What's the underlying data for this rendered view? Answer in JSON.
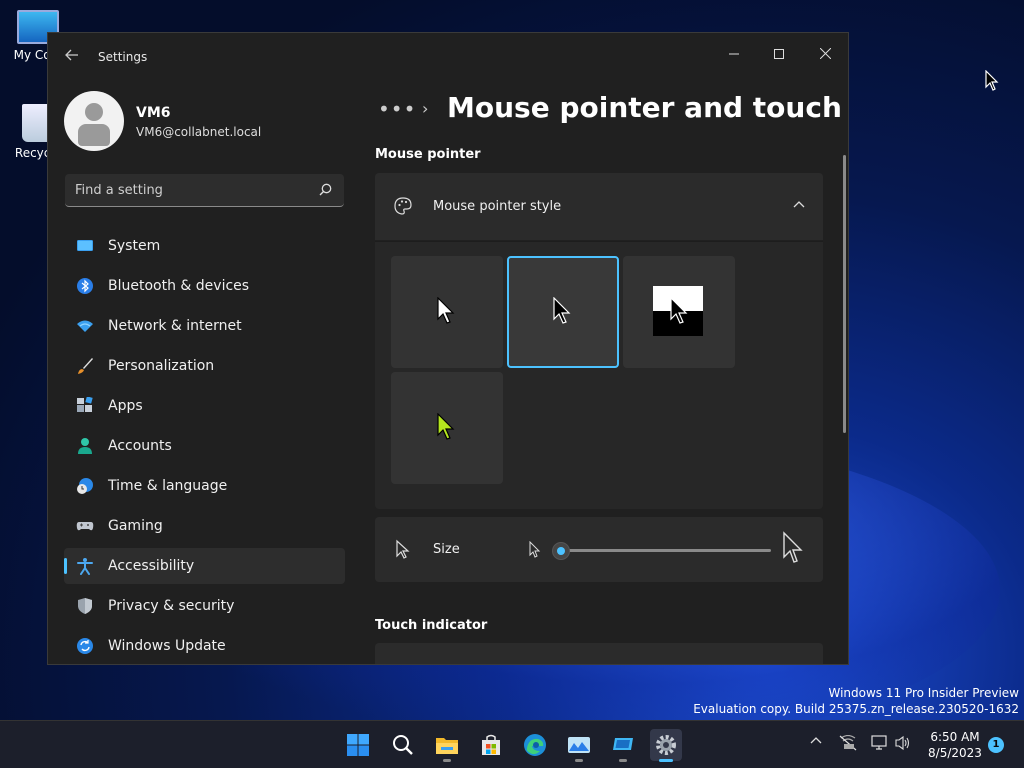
{
  "desktop": {
    "icons": [
      {
        "label": "My Com"
      },
      {
        "label": "Recycle"
      }
    ],
    "watermark": {
      "line1": "Windows 11 Pro Insider Preview",
      "line2": "Evaluation copy. Build 25375.zn_release.230520-1632"
    }
  },
  "window": {
    "title": "Settings",
    "controls": {
      "minimize": "—",
      "maximize": "☐",
      "close": "✕"
    }
  },
  "profile": {
    "name": "VM6",
    "email": "VM6@collabnet.local"
  },
  "search": {
    "placeholder": "Find a setting"
  },
  "nav": {
    "items": [
      {
        "label": "System",
        "icon": "system-icon"
      },
      {
        "label": "Bluetooth & devices",
        "icon": "bluetooth-icon"
      },
      {
        "label": "Network & internet",
        "icon": "wifi-icon"
      },
      {
        "label": "Personalization",
        "icon": "brush-icon"
      },
      {
        "label": "Apps",
        "icon": "apps-icon"
      },
      {
        "label": "Accounts",
        "icon": "person-icon"
      },
      {
        "label": "Time & language",
        "icon": "globe-clock-icon"
      },
      {
        "label": "Gaming",
        "icon": "controller-icon"
      },
      {
        "label": "Accessibility",
        "icon": "accessibility-icon",
        "active": true
      },
      {
        "label": "Privacy & security",
        "icon": "shield-icon"
      },
      {
        "label": "Windows Update",
        "icon": "update-icon"
      }
    ]
  },
  "content": {
    "breadcrumb_dots": "•••",
    "breadcrumb_chevron": "›",
    "title": "Mouse pointer and touch",
    "sections": {
      "mouse_pointer": "Mouse pointer",
      "touch_indicator": "Touch indicator"
    },
    "pointer_style": {
      "label": "Mouse pointer style",
      "expanded": true,
      "styles": [
        {
          "name": "white"
        },
        {
          "name": "black",
          "selected": true
        },
        {
          "name": "inverted"
        },
        {
          "name": "custom",
          "color": "#b4e61e"
        }
      ]
    },
    "size": {
      "label": "Size",
      "value": 1,
      "min": 1,
      "max": 15
    }
  },
  "taskbar": {
    "apps": [
      {
        "name": "start-icon"
      },
      {
        "name": "search-icon"
      },
      {
        "name": "file-explorer-icon"
      },
      {
        "name": "store-icon"
      },
      {
        "name": "edge-icon"
      },
      {
        "name": "photos-icon"
      },
      {
        "name": "remote-desktop-icon"
      },
      {
        "name": "settings-icon",
        "active": true
      }
    ],
    "clock": {
      "time": "6:50 AM",
      "date": "8/5/2023"
    },
    "notifications": "1"
  },
  "colors": {
    "accent": "#4cc2ff",
    "window_bg": "#202020",
    "card_bg": "#2b2b2b"
  }
}
